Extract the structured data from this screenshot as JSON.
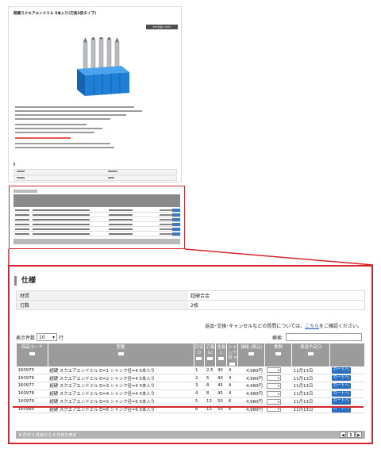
{
  "thumb": {
    "title": "超硬スクエアエンドミル 5本入り(刃長3倍タイプ)",
    "button_label": "PDFを開く(PDF)"
  },
  "spec": {
    "heading": "仕様",
    "rows": [
      {
        "key": "材質",
        "value": "超硬合金"
      },
      {
        "key": "刃数",
        "value": "2枚"
      }
    ],
    "note_prefix": "返品･交換･キャンセルなどの質問については、",
    "note_link": "こちら",
    "note_suffix": "をご確認ください。"
  },
  "table_controls": {
    "count_label_before": "表示件数",
    "count_value": "10",
    "count_label_after": "行",
    "search_label": "検索:"
  },
  "table": {
    "headers": [
      "商品コード",
      "型番",
      "刃径 D",
      "刃長 Lc",
      "全長 L",
      "シャンク径 d",
      "価格 (税込)",
      "数数",
      "発送予定日",
      ""
    ],
    "rows": [
      {
        "code": "160975",
        "model": "超硬 スクエアエンドミル D=1 シャンク径=4 5本入り",
        "d": "1",
        "lc": "2.5",
        "l": "40",
        "s": "4",
        "price": "4,980円",
        "ship": "11月13日",
        "cart": "カートへ"
      },
      {
        "code": "160976",
        "model": "超硬 スクエアエンドミル D=2 シャンク径=4 5本入り",
        "d": "2",
        "lc": "5",
        "l": "40",
        "s": "4",
        "price": "4,980円",
        "ship": "11月13日",
        "cart": "カートへ"
      },
      {
        "code": "160977",
        "model": "超硬 スクエアエンドミル D=3 シャンク径=4 5本入り",
        "d": "3",
        "lc": "8",
        "l": "45",
        "s": "4",
        "price": "4,980円",
        "ship": "11月13日",
        "cart": "カートへ"
      },
      {
        "code": "160978",
        "model": "超硬 スクエアエンドミル D=4 シャンク径=4 5本入り",
        "d": "4",
        "lc": "8",
        "l": "45",
        "s": "4",
        "price": "4,980円",
        "ship": "11月13日",
        "cart": "カートへ"
      },
      {
        "code": "160979",
        "model": "超硬 スクエアエンドミル D=5 シャンク径=6 5本入り",
        "d": "5",
        "lc": "13",
        "l": "50",
        "s": "6",
        "price": "4,980円",
        "ship": "11月13日",
        "cart": "カートへ"
      },
      {
        "code": "160980",
        "model": "超硬 スクエアエンドミル D=6 シャンク径=6 5本入り",
        "d": "6",
        "lc": "13",
        "l": "50",
        "s": "6",
        "price": "4,980円",
        "ship": "11月13日",
        "cart": "カートへ"
      }
    ],
    "footer_info": "6 件中 1 件目から 6 件目を表示",
    "page_current": "1",
    "prev_icon": "◀",
    "next_icon": "▶"
  },
  "colors": {
    "highlight": "#d4262c",
    "header_gray": "#9b9b9b",
    "cart_blue": "#2c6fbf",
    "product_blue": "#1f7fd6"
  }
}
